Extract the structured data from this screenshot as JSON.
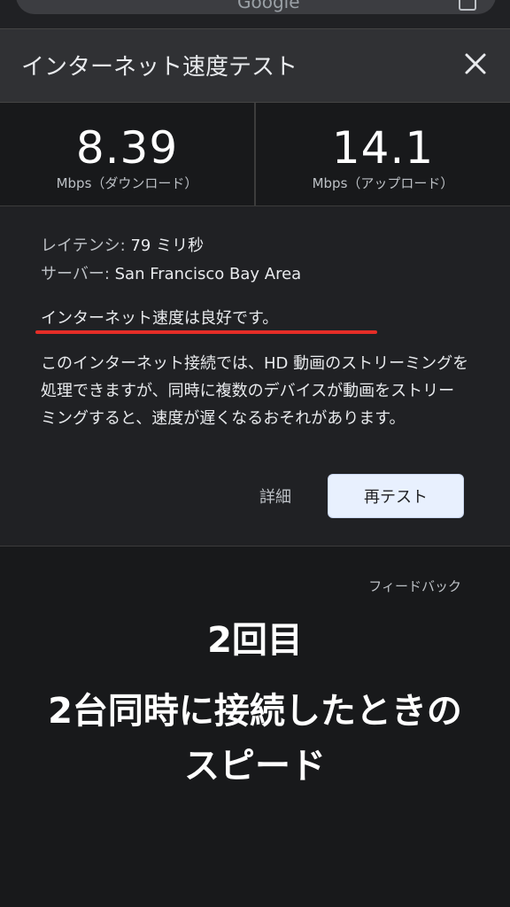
{
  "search": {
    "text": "Google"
  },
  "dialog": {
    "title": "インターネット速度テスト"
  },
  "results": {
    "download": {
      "value": "8.39",
      "unit": "Mbps（ダウンロード）"
    },
    "upload": {
      "value": "14.1",
      "unit": "Mbps（アップロード）"
    }
  },
  "details": {
    "latency_label": "レイテンシ:",
    "latency_value": "79 ミリ秒",
    "server_label": "サーバー:",
    "server_value": "San Francisco Bay Area",
    "status": "インターネット速度は良好です。",
    "description": "このインターネット接続では、HD 動画のストリーミングを処理できますが、同時に複数のデバイスが動画をストリーミングすると、速度が遅くなるおそれがあります。",
    "detail_link": "詳細",
    "retest_label": "再テスト"
  },
  "feedback": "フィードバック",
  "caption": {
    "line1": "2回目",
    "line2": "2台同時に接続したときの",
    "line3": "スピード"
  },
  "colors": {
    "accent_underline": "#e52d27",
    "button_bg": "#e8f0fe"
  }
}
